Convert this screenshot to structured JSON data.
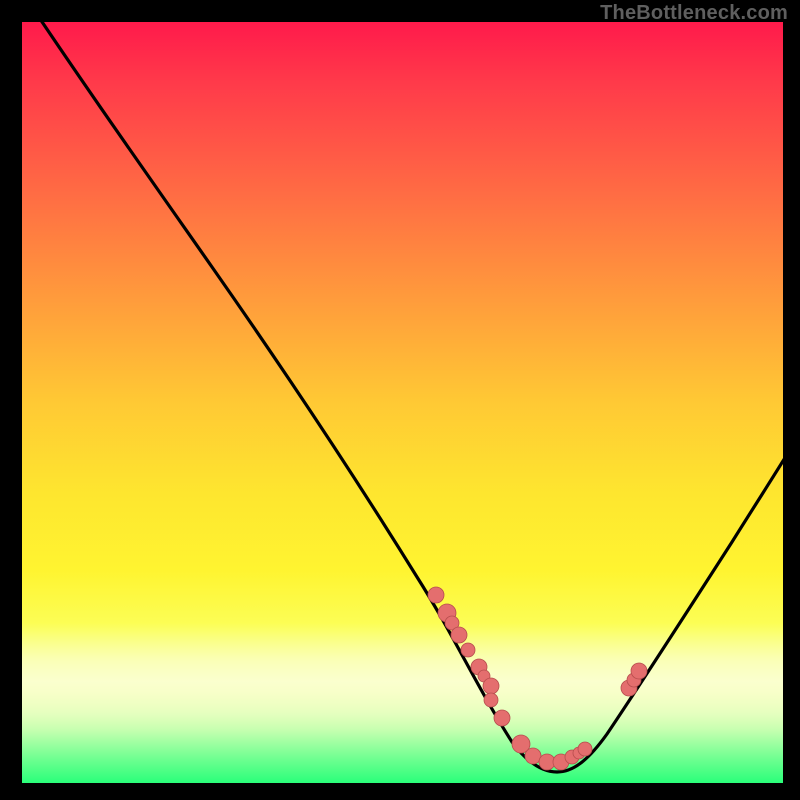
{
  "watermark": "TheBottleneck.com",
  "colors": {
    "dot_fill": "#e46e6e",
    "dot_stroke": "#b64d4d",
    "curve": "#000000"
  },
  "chart_data": {
    "type": "line",
    "title": "",
    "xlabel": "",
    "ylabel": "",
    "xlim": [
      0,
      100
    ],
    "ylim": [
      0,
      100
    ],
    "note": "No axis ticks or labels shown; values approximated from pixel positions (origin lower-left). y ≈ bottleneck metric (100 high, 0 low); curve shows a V-shape with minimum near x≈68.",
    "series": [
      {
        "name": "bottleneck-curve",
        "x": [
          0,
          8,
          15,
          22,
          30,
          38,
          45,
          52,
          55,
          58,
          61,
          64,
          67,
          70,
          73,
          76,
          80,
          85,
          90,
          95,
          100
        ],
        "y": [
          104,
          93,
          83,
          73,
          62,
          50,
          39,
          27,
          22,
          16,
          10,
          5,
          2,
          1,
          2,
          5,
          11,
          20,
          30,
          41,
          53
        ]
      }
    ],
    "dots": {
      "name": "data points (salmon)",
      "x": [
        54.4,
        55.8,
        56.5,
        57.4,
        58.6,
        60.0,
        60.7,
        61.6,
        61.6,
        63.0,
        65.5,
        67.1,
        68.9,
        70.8,
        72.2,
        73.2,
        74.0,
        79.8,
        80.4,
        81.1
      ],
      "y": [
        24.7,
        22.3,
        21.0,
        19.4,
        17.5,
        15.2,
        14.1,
        12.7,
        10.9,
        8.5,
        5.1,
        3.6,
        2.8,
        2.8,
        3.4,
        3.9,
        4.5,
        12.5,
        13.5,
        14.7
      ]
    }
  }
}
